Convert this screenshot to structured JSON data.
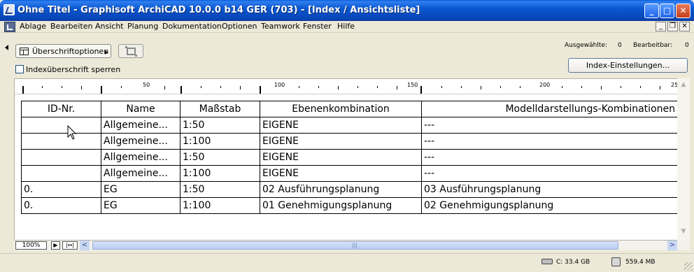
{
  "window": {
    "title": "Ohne Titel - Graphisoft ArchiCAD 10.0.0 b14 GER (703) - [Index /  Ansichtsliste]",
    "minimize": "_",
    "maximize": "□",
    "close": "✕"
  },
  "menubar": {
    "items": [
      "Ablage",
      "Bearbeiten",
      "Ansicht",
      "Planung",
      "Dokumentation",
      "Optionen",
      "Teamwork",
      "Fenster",
      "Hilfe"
    ],
    "mdi_minimize": "_",
    "mdi_restore": "❐",
    "mdi_close": "✕"
  },
  "toolbar": {
    "heading_options_label": "Überschriftoptionen",
    "lock_heading_label": "Indexüberschrift sperren",
    "lock_heading_checked": false,
    "selected_label": "Ausgewählte:",
    "selected_count": "0",
    "editable_label": "Bearbeitbar:",
    "editable_count": "0",
    "index_settings_label": "Index-Einstellungen..."
  },
  "ruler": {
    "labels": [
      "50",
      "100",
      "150",
      "200",
      "25"
    ],
    "more": "..."
  },
  "table": {
    "columns": [
      "ID-Nr.",
      "Name",
      "Maßstab",
      "Ebenenkombination",
      "Modelldarstellungs-Kombinationen"
    ],
    "rows": [
      [
        "",
        "Allgemeine...",
        "1:50",
        "EIGENE",
        "---"
      ],
      [
        "",
        "Allgemeine...",
        "1:100",
        "EIGENE",
        "---"
      ],
      [
        "",
        "Allgemeine...",
        "1:50",
        "EIGENE",
        "---"
      ],
      [
        "",
        "Allgemeine...",
        "1:100",
        "EIGENE",
        "---"
      ],
      [
        "0.",
        "EG",
        "1:50",
        "02 Ausführungsplanung",
        "03 Ausführungsplanung"
      ],
      [
        "0.",
        "EG",
        "1:100",
        "01 Genehmigungsplanung",
        "02 Genehmigungsplanung"
      ]
    ]
  },
  "bottombar": {
    "zoom": "100%",
    "play": "▶",
    "fit": "|↔|",
    "left": "<",
    "right": ">",
    "grip": "|||"
  },
  "statusbar": {
    "disk": "C: 33.4 GB",
    "memory": "559.4 MB"
  }
}
